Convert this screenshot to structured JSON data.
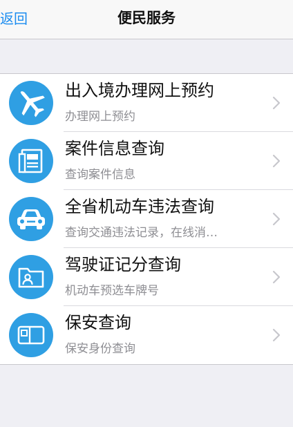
{
  "navbar": {
    "back_label": "返回",
    "title": "便民服务"
  },
  "colors": {
    "accent": "#1a8cf0",
    "icon_bg": "#2f9fe3",
    "background": "#efeff4"
  },
  "items": [
    {
      "title": "出入境办理网上预约",
      "subtitle": "办理网上预约",
      "icon": "airplane-icon"
    },
    {
      "title": "案件信息查询",
      "subtitle": "查询案件信息",
      "icon": "document-icon"
    },
    {
      "title": "全省机动车违法查询",
      "subtitle": "查询交通违法记录，在线消…",
      "icon": "car-icon"
    },
    {
      "title": "驾驶证记分查询",
      "subtitle": "机动车预选车牌号",
      "icon": "id-folder-icon"
    },
    {
      "title": "保安查询",
      "subtitle": "保安身份查询",
      "icon": "id-card-icon"
    }
  ]
}
